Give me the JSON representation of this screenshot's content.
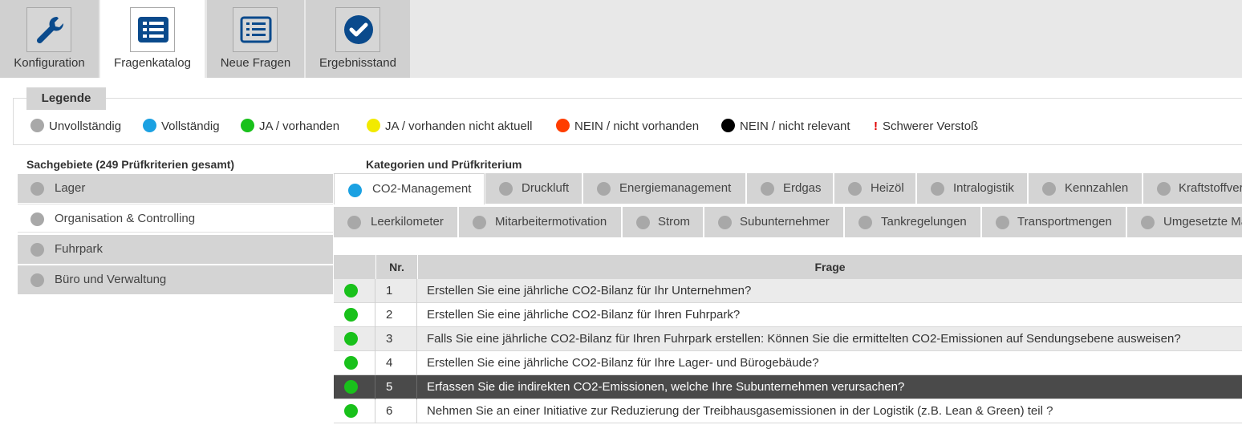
{
  "top_tabs": [
    {
      "label": "Konfiguration",
      "icon": "wrench-icon"
    },
    {
      "label": "Fragenkatalog",
      "icon": "list-icon"
    },
    {
      "label": "Neue Fragen",
      "icon": "list-outline-icon"
    },
    {
      "label": "Ergebnisstand",
      "icon": "check-circle-icon"
    }
  ],
  "legend": {
    "title": "Legende",
    "items": [
      {
        "label": "Unvollständig",
        "color": "#a8a8a8"
      },
      {
        "label": "Vollständig",
        "color": "#1ba1e2"
      },
      {
        "label": "JA / vorhanden",
        "color": "#19c11b"
      },
      {
        "label": "JA / vorhanden nicht aktuell",
        "color": "#f2ea00"
      },
      {
        "label": "NEIN / nicht vorhanden",
        "color": "#ff3d00"
      },
      {
        "label": "NEIN / nicht relevant",
        "color": "#000000"
      },
      {
        "label": "Schwerer Verstoß",
        "marker": "!",
        "color": "#e00000"
      }
    ]
  },
  "sachgebiete": {
    "title": "Sachgebiete (249 Prüfkriterien gesamt)",
    "items": [
      {
        "label": "Lager"
      },
      {
        "label": "Organisation & Controlling"
      },
      {
        "label": "Fuhrpark"
      },
      {
        "label": "Büro und Verwaltung"
      }
    ]
  },
  "kategorien": {
    "title": "Kategorien und Prüfkriterium",
    "row1": [
      "CO2-Management",
      "Druckluft",
      "Energiemanagement",
      "Erdgas",
      "Heizöl",
      "Intralogistik",
      "Kennzahlen",
      "Kraftstoffverbrauch"
    ],
    "row2": [
      "Leerkilometer",
      "Mitarbeitermotivation",
      "Strom",
      "Subunternehmer",
      "Tankregelungen",
      "Transportmengen",
      "Umgesetzte Maßnahmen"
    ]
  },
  "table": {
    "header_nr": "Nr.",
    "header_frage": "Frage",
    "rows": [
      {
        "nr": "1",
        "frage": "Erstellen Sie eine jährliche CO2-Bilanz für Ihr Unternehmen?"
      },
      {
        "nr": "2",
        "frage": "Erstellen Sie eine jährliche CO2-Bilanz für Ihren Fuhrpark?"
      },
      {
        "nr": "3",
        "frage": "Falls Sie eine jährliche CO2-Bilanz für Ihren Fuhrpark erstellen: Können Sie die ermittelten CO2-Emissionen auf Sendungsebene ausweisen?"
      },
      {
        "nr": "4",
        "frage": "Erstellen Sie eine jährliche CO2-Bilanz für Ihre Lager- und Bürogebäude?"
      },
      {
        "nr": "5",
        "frage": "Erfassen Sie die indirekten CO2-Emissionen, welche Ihre Subunternehmen verursachen?"
      },
      {
        "nr": "6",
        "frage": "Nehmen Sie an einer Initiative zur Reduzierung der Treibhausgasemissionen in der Logistik (z.B. Lean & Green) teil ?"
      }
    ]
  }
}
